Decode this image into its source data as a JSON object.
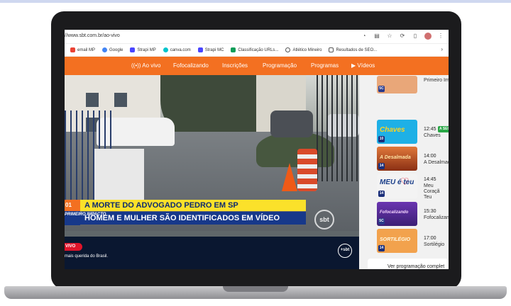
{
  "browser": {
    "url": "//www.sbt.com.br/ao-vivo",
    "bookmarks": [
      {
        "label": "email MP",
        "icon": "gmail-icon",
        "color": "#ea4335"
      },
      {
        "label": "Google",
        "icon": "google-icon",
        "color": "#4285f4"
      },
      {
        "label": "Strapi MP",
        "icon": "strapi-icon",
        "color": "#4945ff"
      },
      {
        "label": "canva.com",
        "icon": "canva-icon",
        "color": "#00c4cc"
      },
      {
        "label": "Strapi MC",
        "icon": "strapi-icon",
        "color": "#4945ff"
      },
      {
        "label": "Classificação URLs...",
        "icon": "sheets-icon",
        "color": "#0f9d58"
      },
      {
        "label": "Atlético Mineiro",
        "icon": "globe-icon",
        "color": "#555555"
      },
      {
        "label": "Resultados de SEO...",
        "icon": "seo-icon",
        "color": "#555555"
      }
    ]
  },
  "nav": {
    "items": [
      "Ao vivo",
      "Fofocalizando",
      "Inscrições",
      "Programação",
      "Programas",
      "Vídeos"
    ],
    "ao_vivo_icon": "((•))",
    "videos_icon": "▶",
    "accent": "#f37021"
  },
  "video": {
    "tag": "01",
    "headline": "A MORTE DO ADVOGADO PEDRO EM SP",
    "subheadline": "HOMEM E MULHER SÃO IDENTIFICADOS EM VÍDEO",
    "show_logo": "PRIMEIRO IMPACTO",
    "bug": "sbt",
    "live": "VIVO",
    "slogan": "mais querida do Brasil.",
    "sbt_plus": "+sbt"
  },
  "schedule": [
    {
      "time": "",
      "program": "Primeiro Im",
      "thumb_title": "",
      "rating": "5C",
      "color": "#e9a779",
      "live": ""
    },
    {
      "time": "12:45",
      "program": "Chaves",
      "thumb_title": "Chaves",
      "rating": "10",
      "color": "#1eb0e6",
      "live": "A SEG"
    },
    {
      "time": "14:00",
      "program": "A Desalmad",
      "thumb_title": "A Desalmada",
      "rating": "14",
      "color": "#d1642a",
      "live": ""
    },
    {
      "time": "14:45",
      "program": "Meu Coraçã Teu",
      "thumb_title": "MEU é teu",
      "rating": "14",
      "color": "#f3f3f3",
      "live": ""
    },
    {
      "time": "15:30",
      "program": "Fofocalizan",
      "thumb_title": "Fofocalizando",
      "rating": "5C",
      "color": "#5a2b9a",
      "live": ""
    },
    {
      "time": "17:00",
      "program": "Sortilégio",
      "thumb_title": "SORTILÉGIO",
      "rating": "14",
      "color": "#f2a24d",
      "live": ""
    }
  ],
  "schedule_button": "Ver programação complet"
}
